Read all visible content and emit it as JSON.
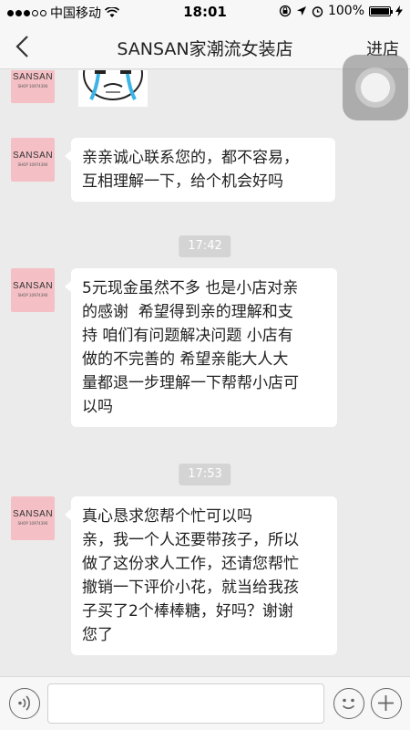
{
  "status_bar": {
    "carrier": "中国移动",
    "time": "18:01",
    "battery": "100%"
  },
  "nav": {
    "title": "SANSAN家潮流女装店",
    "store_link": "进店"
  },
  "avatar": {
    "brand": "SANSAN",
    "tagline": "SHOP 10974390"
  },
  "messages": [
    {
      "text": "亲亲诚心联系您的，都不容易，\n互相理解一下，给个机会好吗"
    },
    {
      "text": "5元现金虽然不多 也是小店对亲\n的感谢  希望得到亲的理解和支\n持 咱们有问题解决问题 小店有\n做的不完善的 希望亲能大人大\n量都退一步理解一下帮帮小店可\n以吗"
    },
    {
      "text": "真心恳求您帮个忙可以吗\n亲，我一个人还要带孩子，所以\n做了这份求人工作，还请您帮忙\n撤销一下评价小花，就当给我孩\n子买了2个棒棒糖，好吗？谢谢\n您了"
    }
  ],
  "timestamps": [
    "17:42",
    "17:53"
  ],
  "icons": {
    "back": "chevron-left-icon",
    "voice": "voice-icon",
    "emoji": "smiley-icon",
    "more": "plus-icon"
  }
}
